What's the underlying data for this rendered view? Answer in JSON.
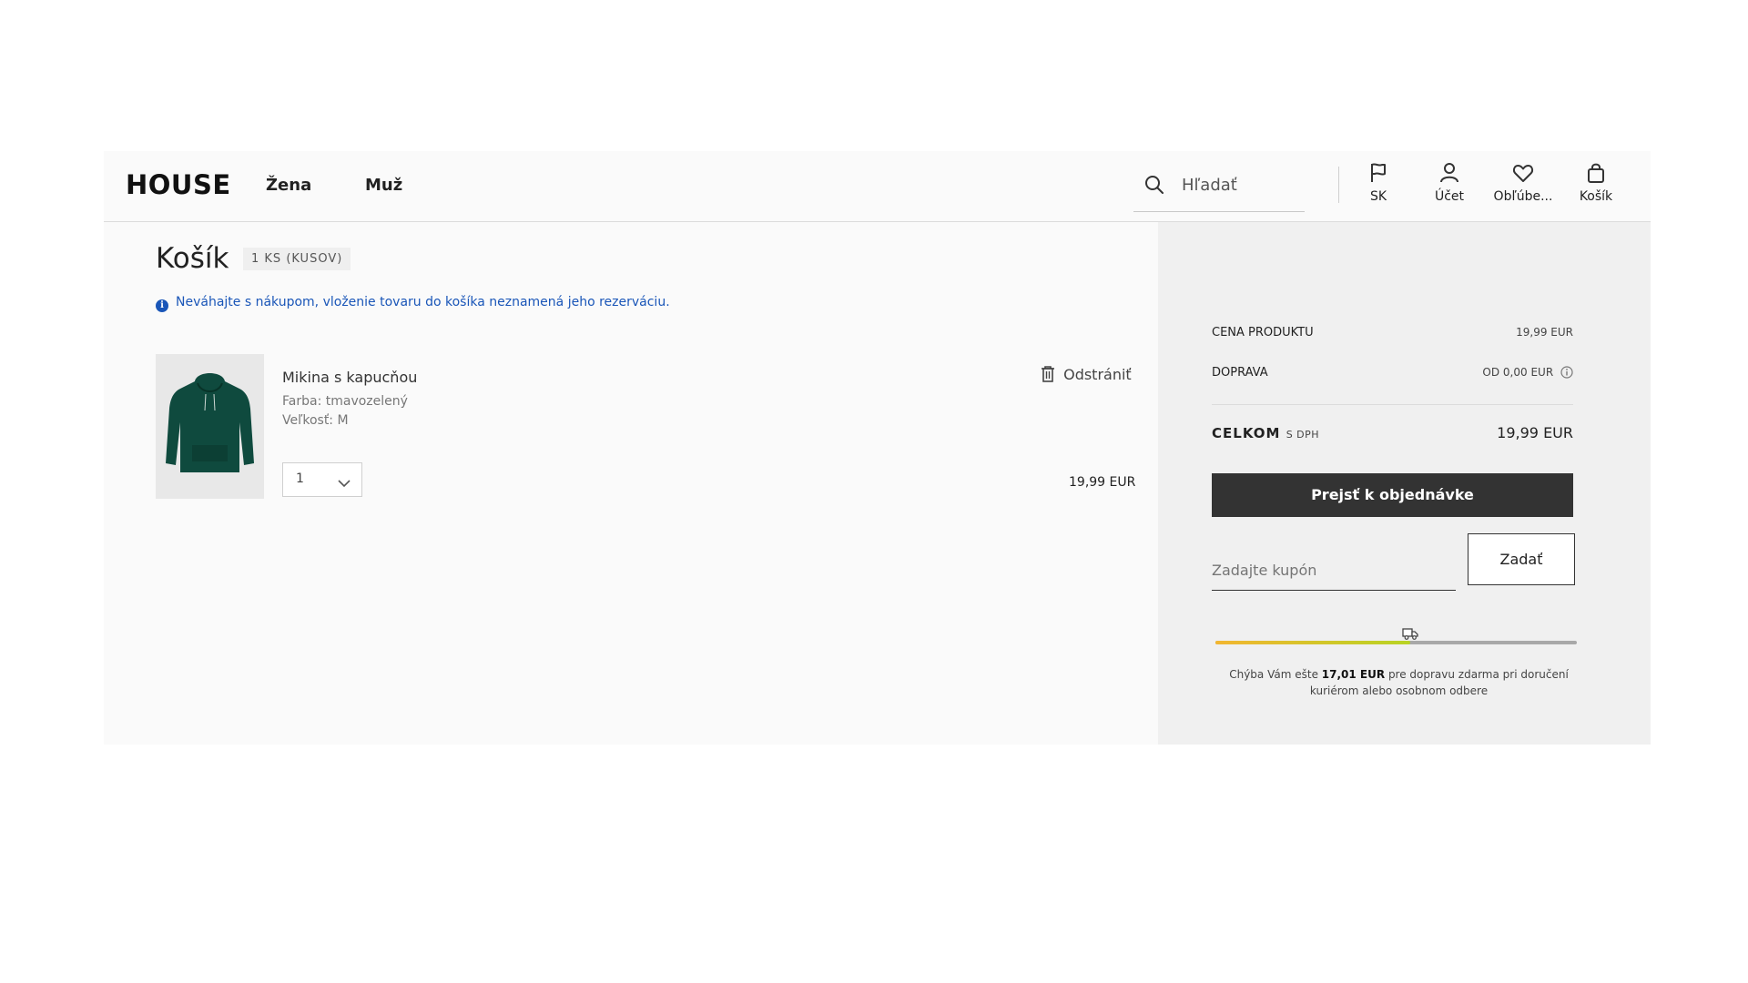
{
  "header": {
    "logo": "HOUSE",
    "nav": [
      "Žena",
      "Muž"
    ],
    "search_placeholder": "Hľadať",
    "icons": [
      {
        "name": "flag-icon",
        "label": "SK"
      },
      {
        "name": "user-icon",
        "label": "Účet"
      },
      {
        "name": "heart-icon",
        "label": "Obľúbe..."
      },
      {
        "name": "bag-icon",
        "label": "Košík"
      }
    ]
  },
  "cart": {
    "title": "Košík",
    "count_badge": "1 KS (KUSOV)",
    "info": "Neváhajte s nákupom, vloženie tovaru do košíka neznamená jeho rezerváciu.",
    "remove_label": "Odstrániť",
    "item": {
      "name": "Mikina s kapucňou",
      "color": "Farba: tmavozelený",
      "size": "Veľkosť: M",
      "quantity": "1",
      "price": "19,99 EUR"
    }
  },
  "summary": {
    "product_label": "CENA PRODUKTU",
    "product_value": "19,99 EUR",
    "shipping_label": "DOPRAVA",
    "shipping_value": "OD 0,00 EUR",
    "total_label": "CELKOM",
    "total_suffix": "S DPH",
    "total_value": "19,99 EUR",
    "order_button": "Prejsť k objednávke",
    "coupon_placeholder": "Zadajte kupón",
    "coupon_button": "Zadať",
    "free_shipping_progress": 0.54,
    "free_shipping_pre": "Chýba Vám ešte",
    "free_shipping_amount": "17,01 EUR",
    "free_shipping_post": "pre dopravu zdarma pri doručení kuriérom alebo osobnom odbere"
  },
  "colors": {
    "accent_blue": "#1a56b8",
    "button_dark": "#333333",
    "product_green": "#0f4a3e"
  }
}
